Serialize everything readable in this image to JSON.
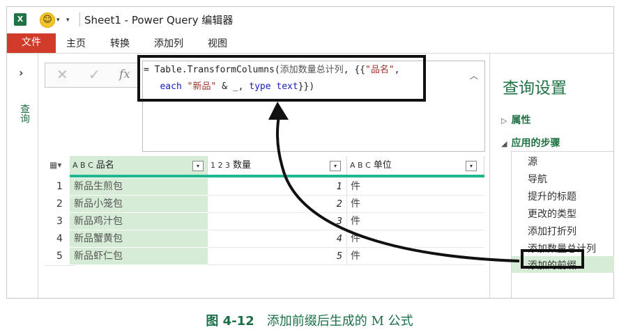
{
  "titlebar": {
    "app_icon": "X",
    "title": "Sheet1 - Power Query 编辑器"
  },
  "menu": {
    "file": "文件",
    "tabs": [
      "主页",
      "转换",
      "添加列",
      "视图"
    ]
  },
  "left_pane": {
    "label": "查询"
  },
  "formula_bar": {
    "cancel_icon": "✕",
    "confirm_icon": "✓",
    "fx_icon": "fx",
    "line1_prefix": "= Table.TransformColumns(",
    "line1_name": "添加数量总计列",
    "line1_mid": ", {{",
    "line1_str": "\"品名\"",
    "line1_end": ",",
    "line2_indent": "   ",
    "line2_each": "each",
    "line2_str": "\"新品\"",
    "line2_mid": " & _, ",
    "line2_type": "type",
    "line2_text": "text",
    "line2_end": "}})"
  },
  "table": {
    "columns": [
      {
        "type_icon": "A B C",
        "name": "品名"
      },
      {
        "type_icon": "1 2 3",
        "name": "数量"
      },
      {
        "type_icon": "A B C",
        "name": "单位"
      }
    ],
    "rows": [
      {
        "n": "1",
        "name": "新品生煎包",
        "qty": "1",
        "unit": "件"
      },
      {
        "n": "2",
        "name": "新品小笼包",
        "qty": "2",
        "unit": "件"
      },
      {
        "n": "3",
        "name": "新品鸡汁包",
        "qty": "3",
        "unit": "件"
      },
      {
        "n": "4",
        "name": "新品蟹黄包",
        "qty": "4",
        "unit": "件"
      },
      {
        "n": "5",
        "name": "新品虾仁包",
        "qty": "5",
        "unit": "件"
      }
    ]
  },
  "settings": {
    "title": "查询设置",
    "properties": "属性",
    "applied_steps": "应用的步骤",
    "steps": [
      "源",
      "导航",
      "提升的标题",
      "更改的类型",
      "添加打折列",
      "添加数量总计列",
      "添加的前缀"
    ],
    "active_step": "添加的前缀"
  },
  "caption": {
    "number": "图 4-12",
    "text": "添加前缀后生成的 M 公式"
  },
  "colors": {
    "accent_green": "#217346",
    "file_red": "#d13b2a",
    "selected_col": "#d6ecd6",
    "header_bar": "#1db88e"
  }
}
